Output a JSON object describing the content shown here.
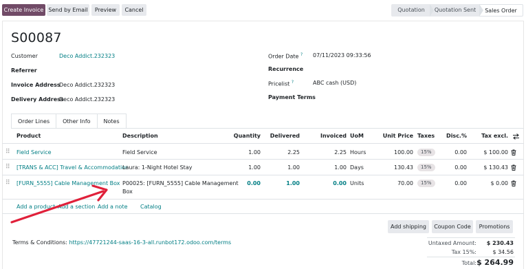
{
  "toolbar": {
    "create_invoice": "Create Invoice",
    "send_by_email": "Send by Email",
    "preview": "Preview",
    "cancel": "Cancel"
  },
  "status": {
    "stages": [
      "Quotation",
      "Quotation Sent",
      "Sales Order"
    ],
    "active": "Sales Order"
  },
  "order": {
    "name": "S00087",
    "customer_label": "Customer",
    "customer": "Deco Addict.232323",
    "referrer_label": "Referrer",
    "invoice_address_label": "Invoice Address",
    "invoice_address": "Deco Addict.232323",
    "delivery_address_label": "Delivery Address",
    "delivery_address": "Deco Addict.232323",
    "order_date_label": "Order Date",
    "order_date_help": "?",
    "order_date": "07/11/2023 09:33:56",
    "recurrence_label": "Recurrence",
    "pricelist_label": "Pricelist",
    "pricelist_help": "?",
    "pricelist": "ABC cash (USD)",
    "payment_terms_label": "Payment Terms"
  },
  "tabs": [
    "Order Lines",
    "Other Info",
    "Notes"
  ],
  "table": {
    "headers": {
      "product": "Product",
      "description": "Description",
      "quantity": "Quantity",
      "delivered": "Delivered",
      "invoiced": "Invoiced",
      "uom": "UoM",
      "unit_price": "Unit Price",
      "taxes": "Taxes",
      "disc": "Disc.%",
      "tax_excl": "Tax excl."
    },
    "rows": [
      {
        "product": "Field Service",
        "description": "Field Service",
        "description2": "",
        "quantity": "1.00",
        "delivered": "2.25",
        "invoiced": "2.25",
        "uom": "Hours",
        "unit_price": "100.00",
        "tax": "15%",
        "disc": "0.00",
        "subtotal": "$ 100.00"
      },
      {
        "product": "[TRANS & ACC] Travel & Accommodation",
        "description": "Laura: 1-Night Hotel Stay",
        "description2": "",
        "quantity": "1.00",
        "delivered": "1.00",
        "invoiced": "1.00",
        "uom": "Days",
        "unit_price": "130.43",
        "tax": "15%",
        "disc": "0.00",
        "subtotal": "$ 130.43"
      },
      {
        "product": "[FURN_5555] Cable Management Box",
        "description": "P00025: [FURN_5555] Cable Management",
        "description2": "Box",
        "quantity": "0.00",
        "delivered": "1.00",
        "invoiced": "0.00",
        "uom": "Units",
        "unit_price": "70.00",
        "tax": "15%",
        "disc": "0.00",
        "subtotal": "$ 0.00"
      }
    ],
    "add_product": "Add a product",
    "add_section": "Add a section",
    "add_note": "Add a note",
    "catalog": "Catalog"
  },
  "actions": {
    "add_shipping": "Add shipping",
    "coupon_code": "Coupon Code",
    "promotions": "Promotions"
  },
  "terms": {
    "label": "Terms & Conditions:",
    "url": "https://47721244-saas-16-3-all.runbot172.odoo.com/terms"
  },
  "totals": {
    "untaxed_label": "Untaxed Amount:",
    "untaxed": "$ 230.43",
    "tax_label": "Tax 15%:",
    "tax": "$ 34.56",
    "total_label": "Total:",
    "total": "$ 264.99"
  },
  "colors": {
    "primary": "#714b67",
    "link": "#017e84",
    "annotation_arrow": "#e0203a"
  }
}
